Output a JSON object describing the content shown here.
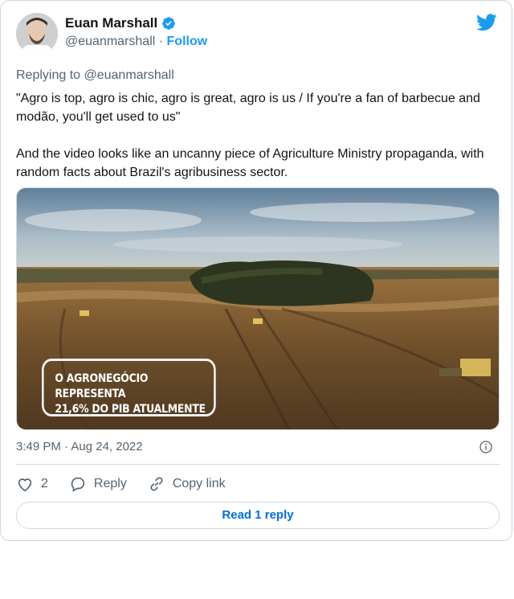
{
  "author": {
    "name": "Euan Marshall",
    "handle": "@euanmarshall",
    "separator": "·",
    "follow_label": "Follow"
  },
  "tweet": {
    "replying_to": "Replying to @euanmarshall",
    "text": "\"Agro is top, agro is chic, agro is great, agro is us / If you're a fan of barbecue and modão, you'll get used to us\"\n\nAnd the video looks like an uncanny piece of Agriculture Ministry propaganda, with random facts about Brazil's agribusiness sector.",
    "media_caption_line1": "O AGRONEGÓCIO REPRESENTA",
    "media_caption_line2": "21,6% DO PIB ATUALMENTE",
    "timestamp": "3:49 PM · Aug 24, 2022"
  },
  "actions": {
    "like_count": "2",
    "reply_label": "Reply",
    "copy_label": "Copy link",
    "read_replies_label": "Read 1 reply"
  },
  "colors": {
    "accent": "#1d9bf0",
    "link": "#006fd6",
    "muted": "#536471",
    "border": "#cfd9de"
  }
}
